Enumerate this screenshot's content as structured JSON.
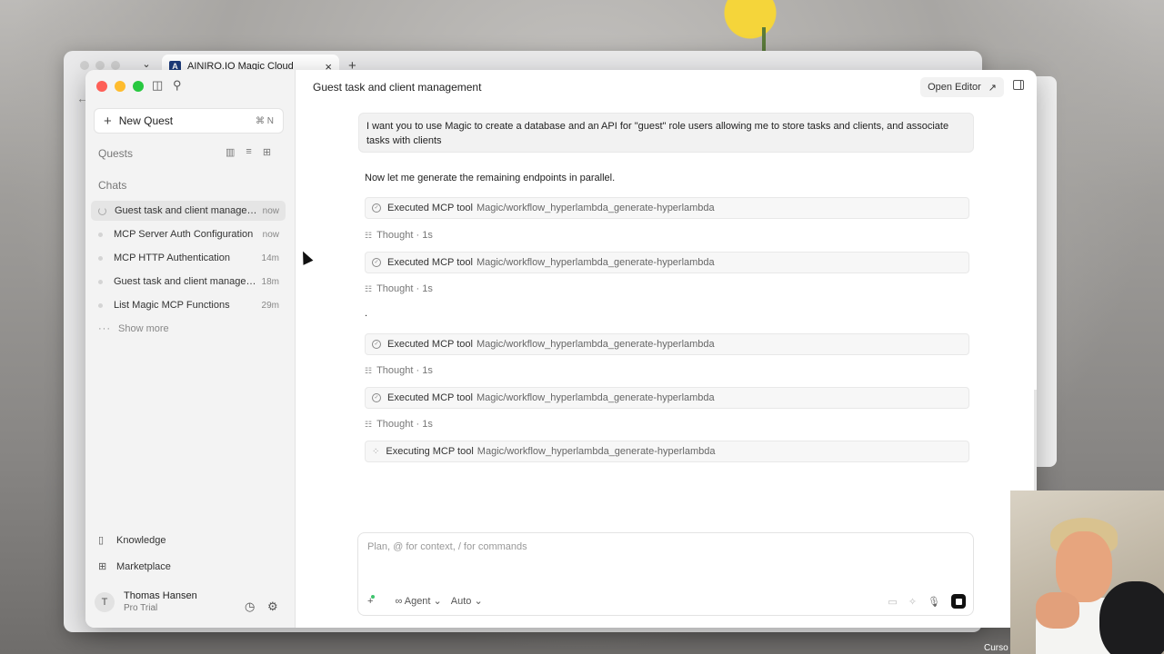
{
  "browser": {
    "tab_title": "AINIRO.IO Magic Cloud",
    "tab_favicon": "A",
    "close_icon": "close-icon",
    "new_tab_icon": "plus-icon"
  },
  "sidebar": {
    "new_quest_label": "New Quest",
    "new_quest_shortcut": "⌘ N",
    "quests_label": "Quests",
    "chats_label": "Chats",
    "chats": [
      {
        "title": "Guest task and client managem...",
        "time": "now",
        "active": true
      },
      {
        "title": "MCP Server Auth Configuration",
        "time": "now"
      },
      {
        "title": "MCP HTTP Authentication",
        "time": "14m"
      },
      {
        "title": "Guest task and client managem...",
        "time": "18m"
      },
      {
        "title": "List Magic MCP Functions",
        "time": "29m"
      }
    ],
    "show_more": "Show more",
    "knowledge": "Knowledge",
    "marketplace": "Marketplace",
    "user": {
      "initial": "T",
      "name": "Thomas Hansen",
      "plan": "Pro Trial"
    }
  },
  "main": {
    "title": "Guest task and client management",
    "open_editor": "Open Editor",
    "user_message": "I want you to use Magic to create a database and an API for \"guest\" role users allowing me to store tasks and clients, and associate tasks with clients",
    "intro_text": "Now let me generate the remaining endpoints in parallel.",
    "period_text": ".",
    "tool_name": "Magic/workflow_hyperlambda_generate-hyperlambda",
    "executed_label": "Executed MCP tool",
    "executing_label": "Executing MCP tool",
    "thought_label": "Thought · 1s",
    "composer_placeholder": "Plan, @ for context, / for commands",
    "agent_label": "Agent",
    "auto_label": "Auto"
  },
  "overlay": {
    "cursor_tag": "Curso"
  },
  "colors": {
    "red": "#fe5f57",
    "yellow": "#febc2e",
    "green": "#28c840",
    "accent_dot": "#3ec46d"
  }
}
